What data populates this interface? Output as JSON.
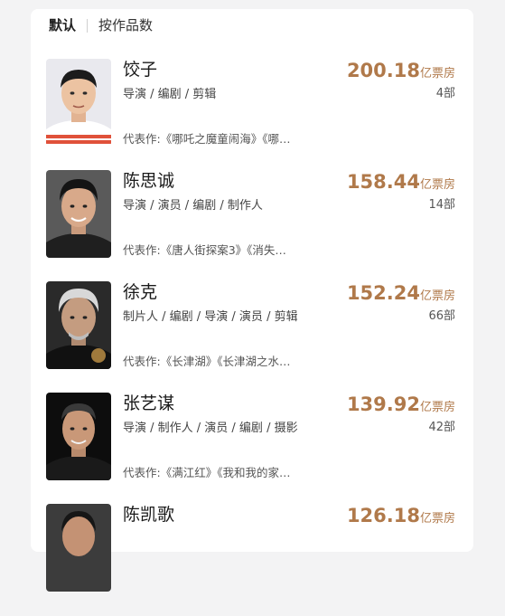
{
  "tabs": [
    {
      "label": "默认",
      "selected": true
    },
    {
      "label": "按作品数",
      "selected": false
    }
  ],
  "box_office_unit": "亿票房",
  "accent_color": "#b0794a",
  "people": [
    {
      "name": "饺子",
      "roles": "导演 / 编剧 / 剪辑",
      "box_office": "200.18",
      "unit": "亿票房",
      "works_count": "4部",
      "representative_works": "代表作:《哪吒之魔童闹海》《哪…"
    },
    {
      "name": "陈思诚",
      "roles": "导演 / 演员 / 编剧 / 制作人",
      "box_office": "158.44",
      "unit": "亿票房",
      "works_count": "14部",
      "representative_works": "代表作:《唐人街探案3》《消失…"
    },
    {
      "name": "徐克",
      "roles": "制片人 / 编剧 / 导演 / 演员 / 剪辑",
      "box_office": "152.24",
      "unit": "亿票房",
      "works_count": "66部",
      "representative_works": "代表作:《长津湖》《长津湖之水…"
    },
    {
      "name": "张艺谋",
      "roles": "导演 / 制作人 / 演员 / 编剧 / 摄影",
      "box_office": "139.92",
      "unit": "亿票房",
      "works_count": "42部",
      "representative_works": "代表作:《满江红》《我和我的家…"
    },
    {
      "name": "陈凯歌",
      "roles": "",
      "box_office": "126.18",
      "unit": "亿票房",
      "works_count": "",
      "representative_works": ""
    }
  ]
}
